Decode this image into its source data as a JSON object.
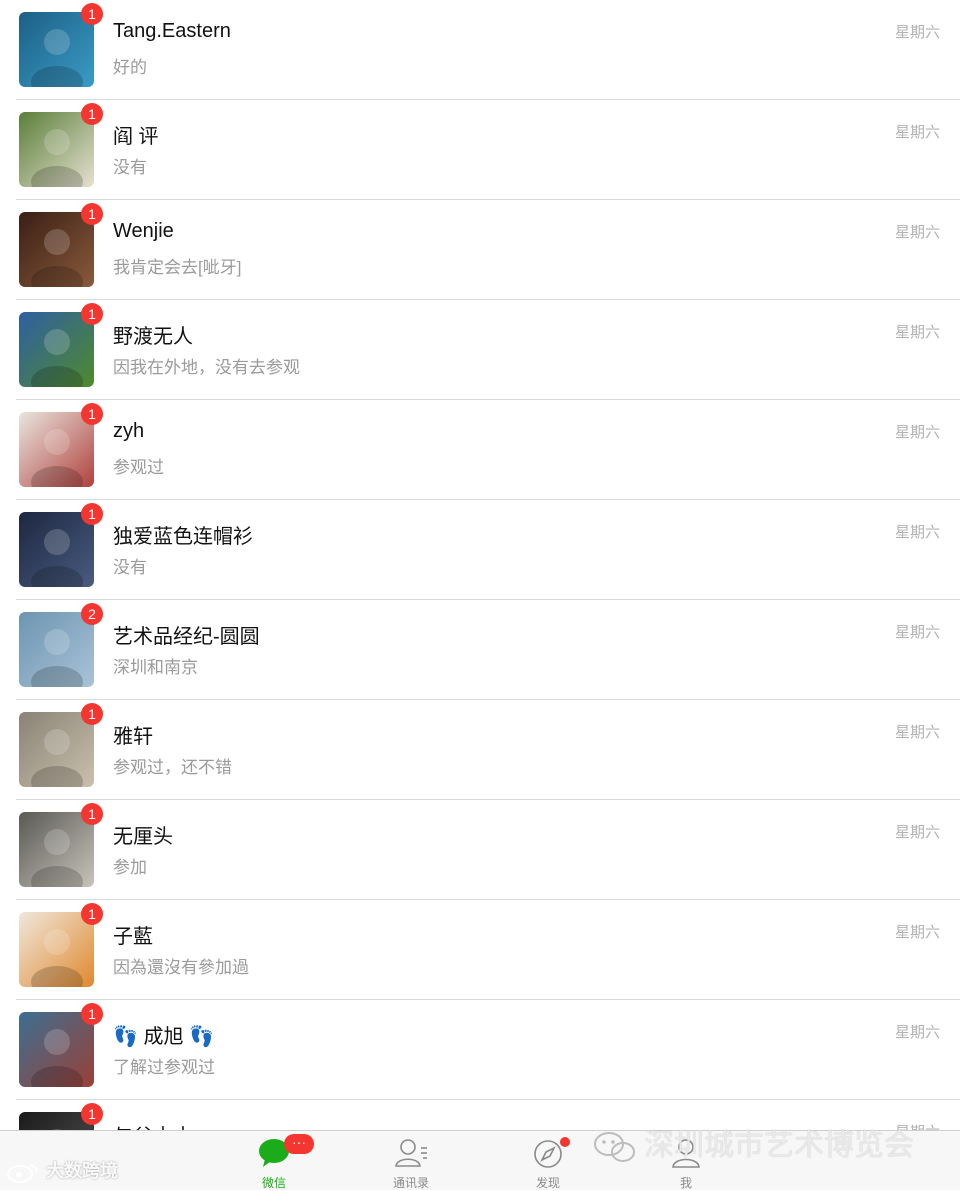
{
  "chats": [
    {
      "name": "Tang.Eastern",
      "preview": "好的",
      "time": "星期六",
      "badge": "1",
      "avatar": "diver-avatar",
      "colors": [
        "#1c5f86",
        "#3a9cc6"
      ]
    },
    {
      "name": "阎 评",
      "preview": "没有",
      "time": "星期六",
      "badge": "1",
      "avatar": "mascot-avatar",
      "colors": [
        "#5b7f3a",
        "#e6e0d0"
      ]
    },
    {
      "name": "Wenjie",
      "preview": "我肯定会去[呲牙]",
      "time": "星期六",
      "badge": "1",
      "avatar": "portrait-avatar",
      "colors": [
        "#3a1f14",
        "#8a5a3c"
      ]
    },
    {
      "name": "野渡无人",
      "preview": "因我在外地，没有去参观",
      "time": "星期六",
      "badge": "1",
      "avatar": "mushroom-avatar",
      "colors": [
        "#2e5fa3",
        "#4f8a2c"
      ]
    },
    {
      "name": "zyh",
      "preview": "参观过",
      "time": "星期六",
      "badge": "1",
      "avatar": "note-avatar",
      "colors": [
        "#e9e5df",
        "#b0413c"
      ]
    },
    {
      "name": "独爱蓝色连帽衫",
      "preview": "没有",
      "time": "星期六",
      "badge": "1",
      "avatar": "hoodie-avatar",
      "colors": [
        "#1d2740",
        "#4a5c80"
      ]
    },
    {
      "name": "艺术品经纪-圆圆",
      "preview": "深圳和南京",
      "time": "星期六",
      "badge": "2",
      "avatar": "sea-avatar",
      "colors": [
        "#6d95b2",
        "#a9c3d6"
      ]
    },
    {
      "name": "雅轩",
      "preview": "参观过，还不错",
      "time": "星期六",
      "badge": "1",
      "avatar": "calligraphy-avatar",
      "colors": [
        "#8a8275",
        "#c9c0ad"
      ]
    },
    {
      "name": "无厘头",
      "preview": "参加",
      "time": "星期六",
      "badge": "1",
      "avatar": "tent-avatar",
      "colors": [
        "#5a5954",
        "#c8c4bb"
      ]
    },
    {
      "name": "子藍",
      "preview": "因為還沒有參加過",
      "time": "星期六",
      "badge": "1",
      "avatar": "drink-avatar",
      "colors": [
        "#efe7dc",
        "#e0892e"
      ]
    },
    {
      "name": "👣 成旭 👣",
      "preview": "了解过参观过",
      "time": "星期六",
      "badge": "1",
      "avatar": "boy-avatar",
      "colors": [
        "#3c6f92",
        "#9a4036"
      ]
    },
    {
      "name": "与谷木木",
      "preview": "",
      "time": "星期六",
      "badge": "1",
      "avatar": "dark-avatar",
      "colors": [
        "#1a1a1a",
        "#555555"
      ]
    }
  ],
  "tabs": [
    {
      "label": "微信",
      "icon": "chat-bubble-icon",
      "active": true,
      "badge": "···"
    },
    {
      "label": "通讯录",
      "icon": "contacts-icon",
      "active": false
    },
    {
      "label": "发现",
      "icon": "compass-icon",
      "active": false,
      "dot": true
    },
    {
      "label": "我",
      "icon": "person-icon",
      "active": false
    }
  ],
  "watermarks": {
    "left": "大数跨境",
    "right": "深圳城市艺术博览会"
  },
  "colors": {
    "accent": "#1aad19",
    "badge": "#f43530",
    "time": "#b2b2b2",
    "preview": "#9b9b9b"
  }
}
